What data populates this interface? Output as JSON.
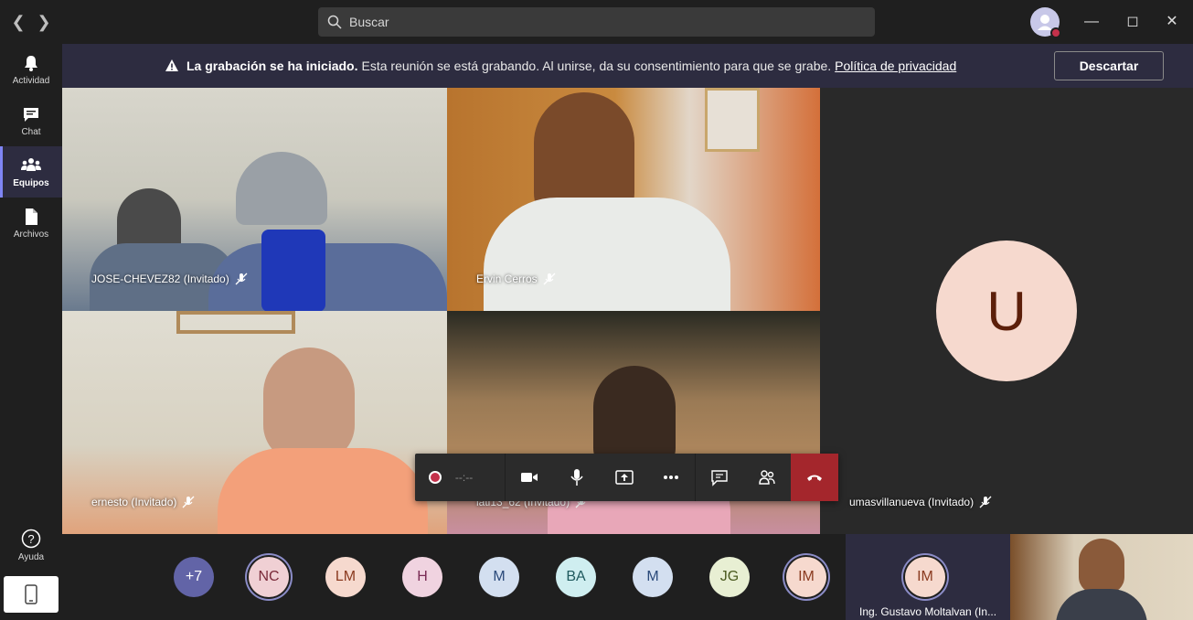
{
  "titlebar": {
    "search_placeholder": "Buscar"
  },
  "rail": {
    "items": [
      {
        "label": "Actividad",
        "icon": "bell-icon"
      },
      {
        "label": "Chat",
        "icon": "chat-icon"
      },
      {
        "label": "Equipos",
        "icon": "teams-icon",
        "active": true
      },
      {
        "label": "Archivos",
        "icon": "file-icon"
      }
    ],
    "help_label": "Ayuda"
  },
  "banner": {
    "bold": "La grabación se ha iniciado.",
    "text": "Esta reunión se está grabando. Al unirse, da su consentimiento para que se grabe.",
    "link": "Política de privacidad",
    "dismiss_label": "Descartar"
  },
  "tiles": [
    {
      "name": "JOSE-CHEVEZ82 (Invitado)"
    },
    {
      "name": "Ervin Cerros"
    },
    {
      "name": "ernesto (Invitado)"
    },
    {
      "name": "lati13_62 (Invitado)"
    },
    {
      "name": "umasvillanueva (Invitado)",
      "initial": "U"
    }
  ],
  "controls": {
    "timer": "--:--"
  },
  "participants": [
    {
      "initials": "+7",
      "bg": "#6264a7",
      "fg": "#ffffff"
    },
    {
      "initials": "NC",
      "bg": "#f0d0d4",
      "fg": "#7a2b3a",
      "ring": true
    },
    {
      "initials": "LM",
      "bg": "#f6d9ce",
      "fg": "#8a3a1f"
    },
    {
      "initials": "H",
      "bg": "#f0d3e0",
      "fg": "#7a2b55"
    },
    {
      "initials": "M",
      "bg": "#d3dff0",
      "fg": "#2b4a7a"
    },
    {
      "initials": "BA",
      "bg": "#cfeef0",
      "fg": "#1f5a5e"
    },
    {
      "initials": "M",
      "bg": "#d3dff0",
      "fg": "#2b4a7a"
    },
    {
      "initials": "JG",
      "bg": "#e8efd3",
      "fg": "#4a5a1f"
    },
    {
      "initials": "IM",
      "bg": "#f6d9ce",
      "fg": "#8a3a1f",
      "ring": true
    }
  ],
  "speaker": {
    "initials": "IM",
    "name": "Ing. Gustavo Moltalvan (In..."
  }
}
